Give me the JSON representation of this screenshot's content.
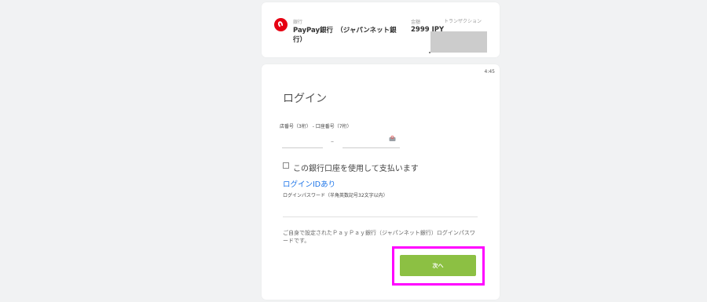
{
  "summary": {
    "bank_label": "銀行",
    "bank_name": "PayPay銀行　（ジャパンネット銀\n行）",
    "amount_label": "金額",
    "amount_value": "2999 JPY",
    "transaction_label": "トランザクション"
  },
  "login": {
    "timer": "4:45",
    "title": "ログイン",
    "account_field_label": "店番号（3桁） - 口座番号（7桁）",
    "branch_value": "",
    "account_value": "",
    "dash": "–",
    "save_account_label": "この銀行口座を使用して支払います",
    "login_id_link": "ログインIDあり",
    "password_label": "ログインパスワード（半角英数記号32文字以内）",
    "note": "ご自身で設定されたＰａｙＰａｙ銀行（ジャパンネット銀行）ログインパスワードです。",
    "next_button": "次へ"
  },
  "colors": {
    "background": "#f1f2f3",
    "bank_brand": "#e60012",
    "button": "#8cc043",
    "highlight": "#ff00ff",
    "link": "#1a73e8"
  }
}
